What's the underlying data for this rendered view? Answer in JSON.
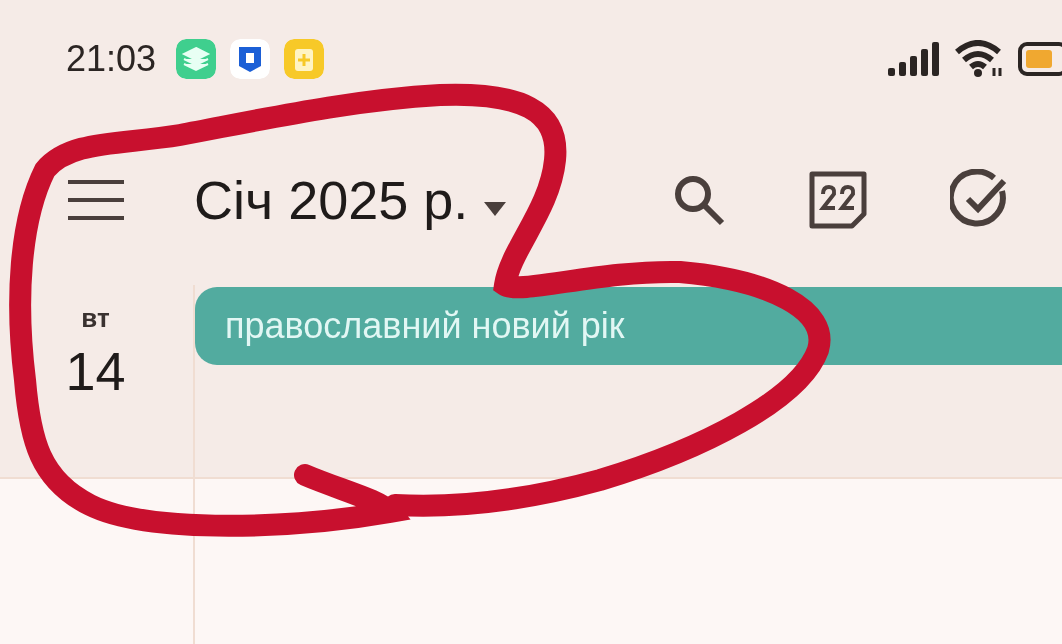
{
  "status_bar": {
    "time": "21:03"
  },
  "toolbar": {
    "title": "Січ 2025 р."
  },
  "day": {
    "weekday": "вт",
    "date": "14"
  },
  "all_day_events": [
    {
      "title": "православний новий рік",
      "color": "#52ab9f"
    }
  ]
}
